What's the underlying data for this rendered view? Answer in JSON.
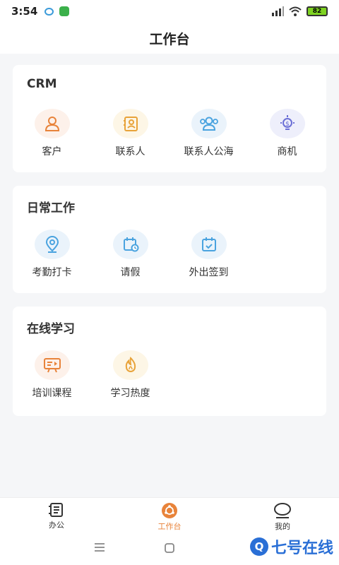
{
  "status_bar": {
    "time": "3:54",
    "battery": "82"
  },
  "header": {
    "title": "工作台"
  },
  "sections": [
    {
      "title": "CRM",
      "items": [
        {
          "label": "客户",
          "icon": "user-icon"
        },
        {
          "label": "联系人",
          "icon": "contact-card-icon"
        },
        {
          "label": "联系人公海",
          "icon": "group-icon"
        },
        {
          "label": "商机",
          "icon": "lightbulb-dollar-icon"
        }
      ]
    },
    {
      "title": "日常工作",
      "items": [
        {
          "label": "考勤打卡",
          "icon": "location-pin-icon"
        },
        {
          "label": "请假",
          "icon": "calendar-clock-icon"
        },
        {
          "label": "外出签到",
          "icon": "calendar-check-icon"
        }
      ]
    },
    {
      "title": "在线学习",
      "items": [
        {
          "label": "培训课程",
          "icon": "presentation-icon"
        },
        {
          "label": "学习热度",
          "icon": "flame-icon"
        }
      ]
    }
  ],
  "tabbar": {
    "tabs": [
      {
        "label": "办公",
        "icon": "notebook-icon"
      },
      {
        "label": "工作台",
        "icon": "workbench-icon",
        "active": true
      },
      {
        "label": "我的",
        "icon": "profile-icon"
      }
    ]
  },
  "watermark": {
    "logo": "Q",
    "text": "七号在线"
  },
  "colors": {
    "accent": "#e8833a",
    "orange_icon": "#e8833a",
    "blue_icon": "#4aa3df",
    "purple_icon": "#6b6fd6"
  }
}
